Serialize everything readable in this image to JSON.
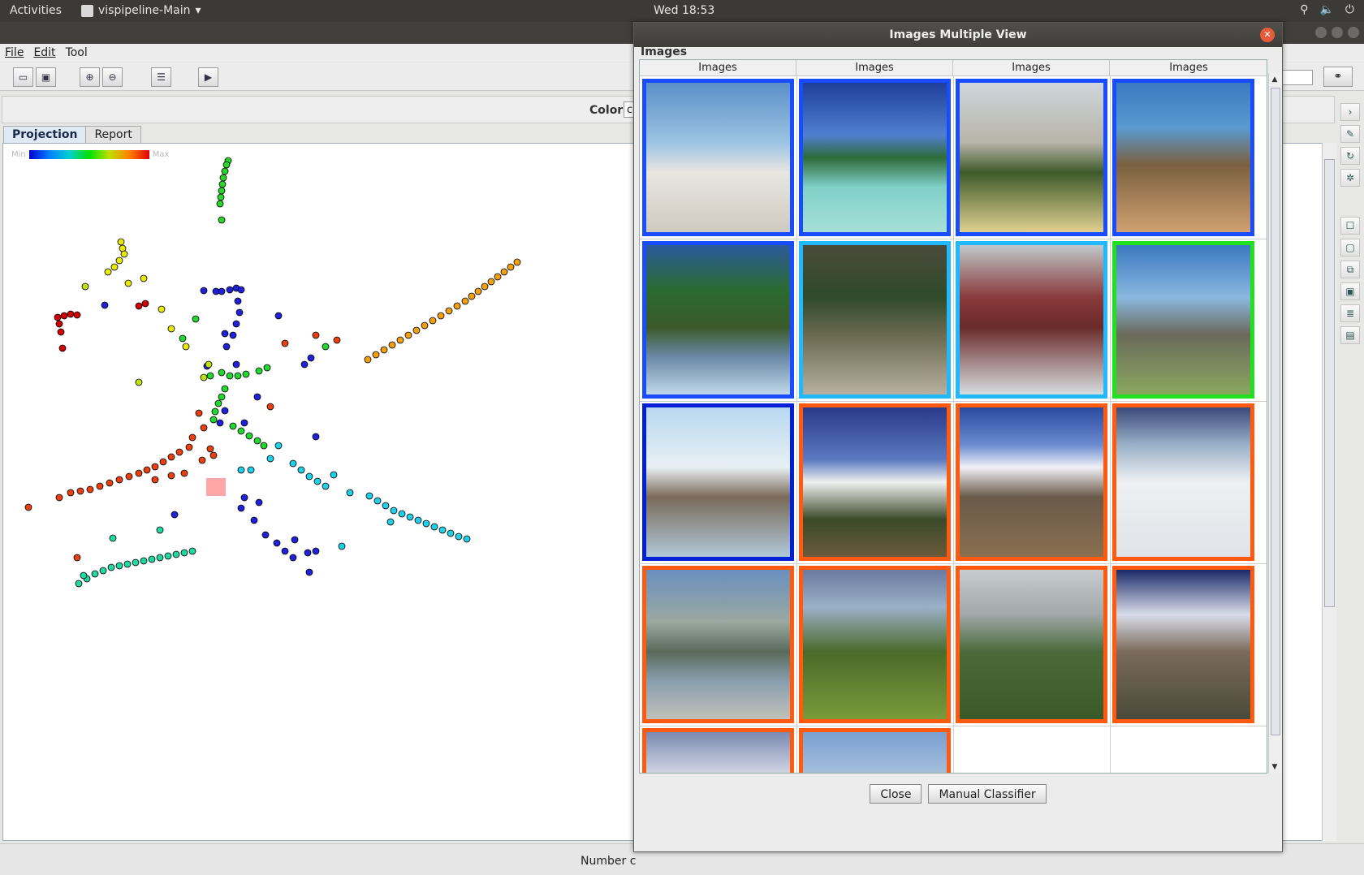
{
  "topbar": {
    "activities": "Activities",
    "app_name": "vispipeline-Main",
    "clock": "Wed 18:53",
    "tray_icons": [
      "accessibility-icon",
      "volume-icon",
      "power-icon"
    ]
  },
  "menu": {
    "file": "File",
    "edit": "Edit",
    "tool": "Tool"
  },
  "toolbar": {
    "open_icon": "folder-open-icon",
    "save_icon": "save-icon",
    "zoom_in_icon": "zoom-in-icon",
    "zoom_out_icon": "zoom-out-icon",
    "settings_icon": "list-settings-icon",
    "run_icon": "play-icon",
    "find_icon": "binoculars-icon"
  },
  "colorbar": {
    "label": "Color",
    "value": "co"
  },
  "tabs": {
    "projection": "Projection",
    "report": "Report"
  },
  "legend": {
    "min": "Min",
    "max": "Max"
  },
  "status": {
    "text": "Number c"
  },
  "colors": {
    "accent_blue": "#1a4cff",
    "border_orange": "#ff5a10"
  },
  "scatter_groups": [
    {
      "color": "#2ad62a",
      "pts": [
        [
          280,
          197
        ],
        [
          278,
          202
        ],
        [
          276,
          210
        ],
        [
          274,
          218
        ],
        [
          273,
          226
        ],
        [
          272,
          234
        ],
        [
          271,
          242
        ],
        [
          270,
          250
        ],
        [
          272,
          270
        ]
      ]
    },
    {
      "color": "#e8e80a",
      "pts": [
        [
          148,
          297
        ],
        [
          150,
          305
        ],
        [
          152,
          312
        ],
        [
          146,
          320
        ],
        [
          140,
          328
        ],
        [
          132,
          334
        ],
        [
          157,
          348
        ],
        [
          176,
          342
        ],
        [
          198,
          380
        ],
        [
          210,
          404
        ],
        [
          228,
          426
        ]
      ]
    },
    {
      "color": "#d00000",
      "pts": [
        [
          70,
          390
        ],
        [
          78,
          388
        ],
        [
          86,
          386
        ],
        [
          94,
          387
        ],
        [
          72,
          398
        ],
        [
          74,
          408
        ],
        [
          76,
          428
        ],
        [
          170,
          376
        ],
        [
          178,
          373
        ]
      ]
    },
    {
      "color": "#2020d8",
      "pts": [
        [
          250,
          357
        ],
        [
          265,
          358
        ],
        [
          272,
          358
        ],
        [
          282,
          356
        ],
        [
          290,
          354
        ],
        [
          296,
          356
        ],
        [
          292,
          370
        ],
        [
          294,
          384
        ],
        [
          290,
          398
        ],
        [
          286,
          412
        ],
        [
          276,
          410
        ],
        [
          278,
          426
        ],
        [
          128,
          375
        ],
        [
          342,
          388
        ],
        [
          382,
          440
        ],
        [
          374,
          448
        ],
        [
          290,
          448
        ],
        [
          254,
          450
        ],
        [
          316,
          488
        ],
        [
          300,
          520
        ],
        [
          270,
          520
        ],
        [
          276,
          505
        ],
        [
          388,
          537
        ],
        [
          214,
          633
        ],
        [
          296,
          625
        ],
        [
          300,
          612
        ],
        [
          318,
          618
        ],
        [
          312,
          640
        ],
        [
          326,
          658
        ],
        [
          340,
          668
        ],
        [
          350,
          678
        ],
        [
          360,
          686
        ],
        [
          378,
          680
        ],
        [
          388,
          678
        ],
        [
          380,
          704
        ],
        [
          362,
          664
        ]
      ]
    },
    {
      "color": "#20d830",
      "pts": [
        [
          258,
          462
        ],
        [
          272,
          458
        ],
        [
          282,
          462
        ],
        [
          292,
          462
        ],
        [
          302,
          460
        ],
        [
          318,
          456
        ],
        [
          328,
          452
        ],
        [
          276,
          478
        ],
        [
          272,
          488
        ],
        [
          268,
          496
        ],
        [
          264,
          506
        ],
        [
          262,
          516
        ],
        [
          286,
          524
        ],
        [
          296,
          530
        ],
        [
          306,
          536
        ],
        [
          316,
          542
        ],
        [
          324,
          548
        ],
        [
          240,
          392
        ],
        [
          224,
          416
        ],
        [
          400,
          426
        ]
      ]
    },
    {
      "color": "#f0a010",
      "pts": [
        [
          636,
          322
        ],
        [
          628,
          328
        ],
        [
          620,
          334
        ],
        [
          612,
          340
        ],
        [
          604,
          346
        ],
        [
          596,
          352
        ],
        [
          588,
          358
        ],
        [
          580,
          364
        ],
        [
          572,
          370
        ],
        [
          562,
          376
        ],
        [
          552,
          382
        ],
        [
          542,
          388
        ],
        [
          532,
          394
        ],
        [
          522,
          400
        ],
        [
          512,
          406
        ],
        [
          502,
          412
        ],
        [
          492,
          418
        ],
        [
          482,
          424
        ],
        [
          472,
          430
        ],
        [
          462,
          436
        ],
        [
          452,
          442
        ]
      ]
    },
    {
      "color": "#e84010",
      "pts": [
        [
          350,
          422
        ],
        [
          388,
          412
        ],
        [
          414,
          418
        ],
        [
          332,
          500
        ],
        [
          244,
          508
        ],
        [
          250,
          526
        ],
        [
          236,
          538
        ],
        [
          232,
          550
        ],
        [
          220,
          556
        ],
        [
          210,
          562
        ],
        [
          200,
          568
        ],
        [
          190,
          574
        ],
        [
          180,
          578
        ],
        [
          170,
          582
        ],
        [
          158,
          586
        ],
        [
          146,
          590
        ],
        [
          134,
          594
        ],
        [
          122,
          598
        ],
        [
          110,
          602
        ],
        [
          98,
          604
        ],
        [
          86,
          606
        ],
        [
          72,
          612
        ],
        [
          34,
          624
        ],
        [
          190,
          590
        ],
        [
          210,
          585
        ],
        [
          226,
          582
        ],
        [
          258,
          552
        ],
        [
          262,
          560
        ],
        [
          248,
          566
        ],
        [
          94,
          686
        ]
      ]
    },
    {
      "color": "#20d0e8",
      "pts": [
        [
          360,
          570
        ],
        [
          370,
          578
        ],
        [
          380,
          586
        ],
        [
          390,
          592
        ],
        [
          400,
          598
        ],
        [
          410,
          584
        ],
        [
          430,
          606
        ],
        [
          454,
          610
        ],
        [
          464,
          616
        ],
        [
          474,
          622
        ],
        [
          484,
          628
        ],
        [
          494,
          632
        ],
        [
          504,
          636
        ],
        [
          514,
          640
        ],
        [
          524,
          644
        ],
        [
          534,
          648
        ],
        [
          544,
          652
        ],
        [
          554,
          656
        ],
        [
          564,
          660
        ],
        [
          574,
          663
        ],
        [
          342,
          548
        ],
        [
          332,
          564
        ],
        [
          308,
          578
        ],
        [
          296,
          578
        ],
        [
          420,
          672
        ],
        [
          480,
          642
        ]
      ]
    },
    {
      "color": "#20d8a0",
      "pts": [
        [
          96,
          718
        ],
        [
          106,
          712
        ],
        [
          116,
          706
        ],
        [
          126,
          702
        ],
        [
          136,
          698
        ],
        [
          146,
          696
        ],
        [
          156,
          694
        ],
        [
          166,
          692
        ],
        [
          176,
          690
        ],
        [
          186,
          688
        ],
        [
          196,
          686
        ],
        [
          206,
          684
        ],
        [
          216,
          682
        ],
        [
          226,
          680
        ],
        [
          236,
          678
        ],
        [
          138,
          662
        ],
        [
          196,
          652
        ],
        [
          102,
          708
        ]
      ]
    },
    {
      "color": "#c0e010",
      "pts": [
        [
          170,
          470
        ],
        [
          104,
          352
        ],
        [
          250,
          464
        ],
        [
          256,
          448
        ]
      ]
    }
  ],
  "dialog": {
    "title": "Images Multiple View",
    "caption": "Images",
    "columns": [
      "Images",
      "Images",
      "Images",
      "Images"
    ],
    "close_button": "Close",
    "manual_button": "Manual Classifier",
    "cells": [
      {
        "border": "#1a4cff",
        "scene": "beach-people-icon"
      },
      {
        "border": "#1a4cff",
        "scene": "tropical-island-icon"
      },
      {
        "border": "#1a4cff",
        "scene": "resort-sailboats-icon"
      },
      {
        "border": "#1a4cff",
        "scene": "beach-kayaks-icon"
      },
      {
        "border": "#1a4cff",
        "scene": "palm-huts-icon"
      },
      {
        "border": "#20b8ff",
        "scene": "ruins-statue-icon"
      },
      {
        "border": "#20b8ff",
        "scene": "temple-interior-icon"
      },
      {
        "border": "#20e020",
        "scene": "elephant-icon"
      },
      {
        "border": "#0020d8",
        "scene": "driftwood-icon"
      },
      {
        "border": "#ff5a10",
        "scene": "snow-peak-icon"
      },
      {
        "border": "#ff5a10",
        "scene": "snowy-mountain-icon"
      },
      {
        "border": "#ff5a10",
        "scene": "climber-snow-icon"
      },
      {
        "border": "#ff5a10",
        "scene": "mountain-lake-icon"
      },
      {
        "border": "#ff5a10",
        "scene": "valley-village-icon"
      },
      {
        "border": "#ff5a10",
        "scene": "green-hills-icon"
      },
      {
        "border": "#ff5a10",
        "scene": "canyon-icon"
      },
      {
        "border": "#ff5a10",
        "scene": "alpine-lake-icon"
      },
      {
        "border": "#ff5a10",
        "scene": "aerial-clouds-icon"
      }
    ]
  }
}
